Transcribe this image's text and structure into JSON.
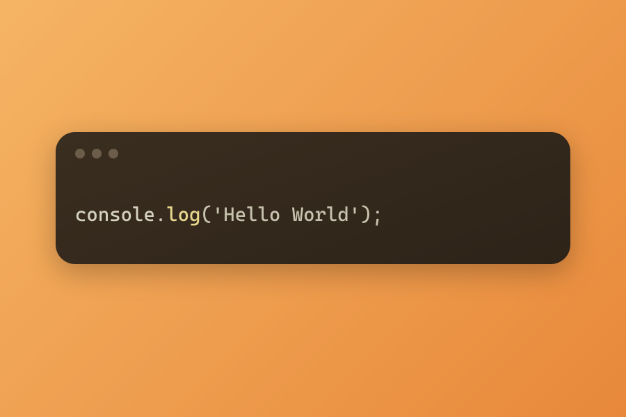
{
  "code": {
    "object": "console",
    "dot": ".",
    "method": "log",
    "open_paren": "(",
    "string": "'Hello World'",
    "close_paren": ")",
    "semicolon": ";"
  }
}
